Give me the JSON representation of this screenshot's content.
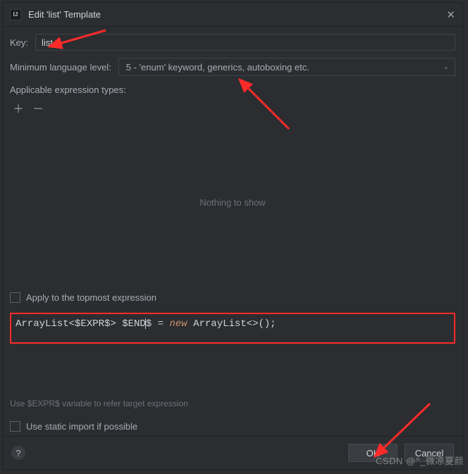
{
  "window": {
    "title": "Edit 'list' Template"
  },
  "key": {
    "label": "Key:",
    "value": "list"
  },
  "minLevel": {
    "label": "Minimum language level:",
    "selected": "5 - 'enum' keyword, generics, autoboxing etc."
  },
  "exprTypes": {
    "label": "Applicable expression types:",
    "empty": "Nothing to show"
  },
  "topmost": {
    "label": "Apply to the topmost expression"
  },
  "code": {
    "t1": "ArrayList<$EXPR$> $END",
    "t2": "$",
    "op": " = ",
    "kw": "new",
    "t3": " ArrayList<>();"
  },
  "hint": "Use $EXPR$ variable to refer target expression",
  "staticImport": {
    "label": "Use static import if possible"
  },
  "buttons": {
    "ok": "OK",
    "cancel": "Cancel"
  },
  "watermark": "CSDN @^_微凉夏颜"
}
